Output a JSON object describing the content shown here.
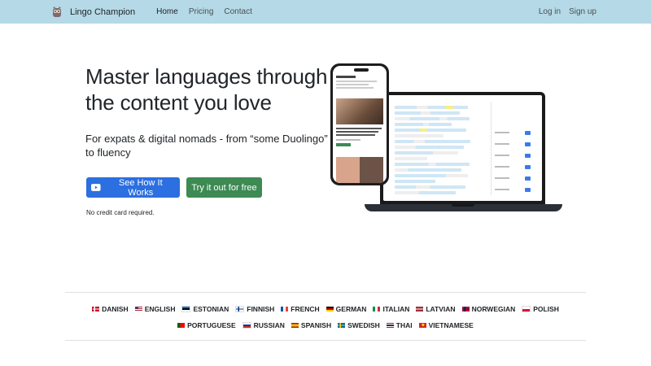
{
  "navbar": {
    "brand": "Lingo Champion",
    "links": [
      "Home",
      "Pricing",
      "Contact"
    ],
    "right_links": [
      "Log in",
      "Sign up"
    ],
    "background": "#b5d9e6"
  },
  "hero": {
    "title_line1": "Master languages through",
    "title_line2": "the content you love",
    "subtitle": "For expats & digital nomads - from “some Duolingo” to fluency",
    "primary_button": "See How It Works",
    "secondary_button": "Try it out for free",
    "note": "No credit card required.",
    "primary_color": "#2b6fe0",
    "secondary_color": "#3d8a53"
  },
  "languages_row1": [
    "DANISH",
    "ENGLISH",
    "ESTONIAN",
    "FINNISH",
    "FRENCH",
    "GERMAN",
    "ITALIAN",
    "LATVIAN",
    "NORWEGIAN",
    "POLISH"
  ],
  "languages_row2": [
    "PORTUGUESE",
    "RUSSIAN",
    "SPANISH",
    "SWEDISH",
    "THAI",
    "VIETNAMESE"
  ]
}
